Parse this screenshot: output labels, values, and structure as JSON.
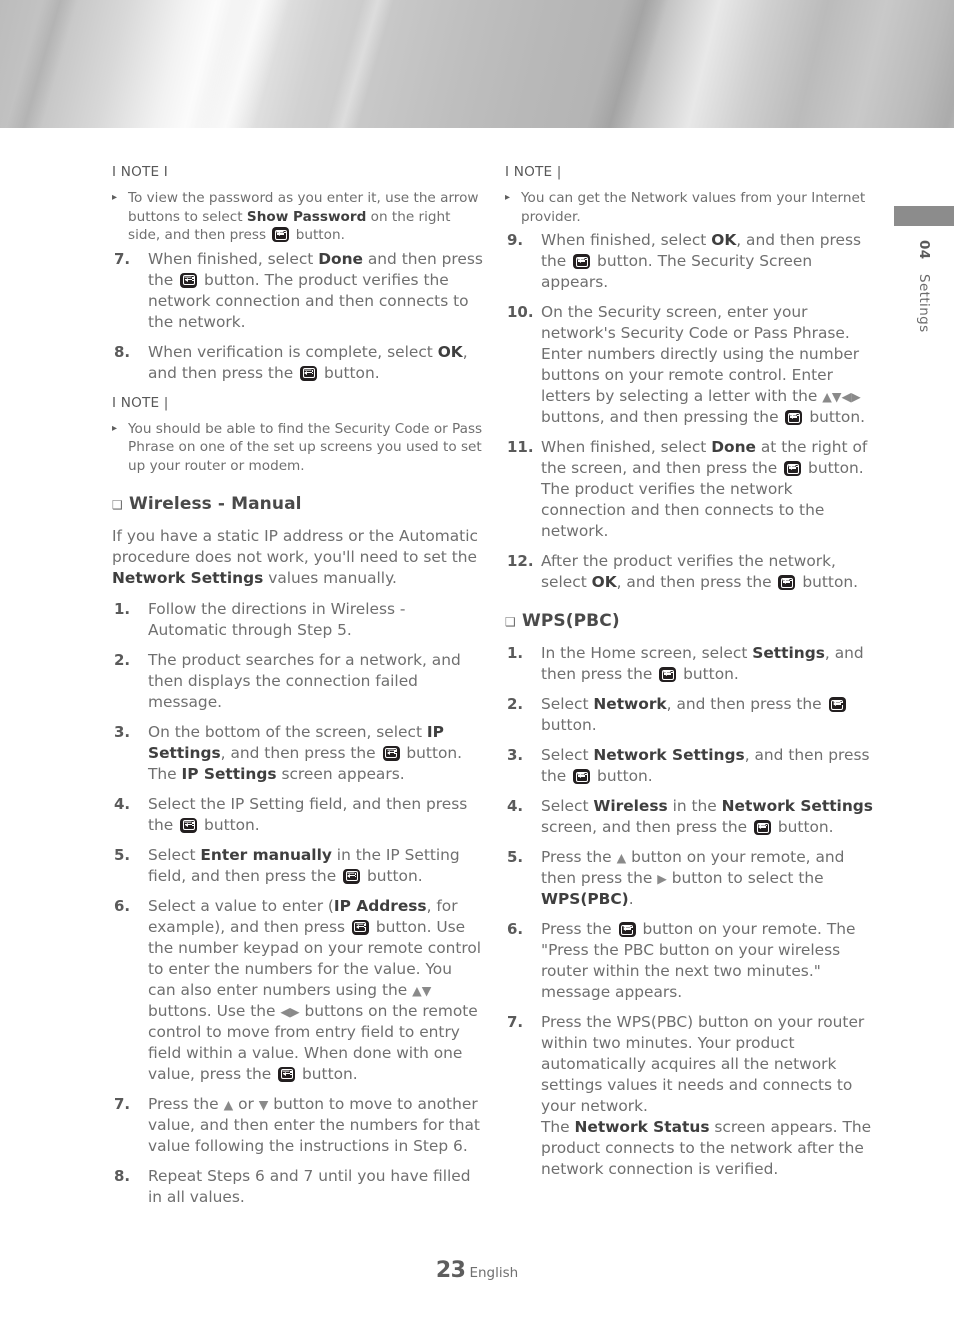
{
  "chapter_tab": {
    "number": "04",
    "name": "Settings"
  },
  "footer": {
    "page_number": "23",
    "language": "English"
  },
  "left_column": {
    "note_1": {
      "title": "I NOTE I",
      "bullet_glyph": "▸",
      "items": [
        {
          "parts": [
            {
              "t": "To view the password as you enter it, use the arrow buttons to select "
            },
            {
              "t": "Show Password",
              "b": true
            },
            {
              "t": " on the right side, and then press "
            },
            {
              "icon": "enter-button-icon"
            },
            {
              "t": " button."
            }
          ]
        }
      ]
    },
    "steps_a": [
      {
        "num": "7.",
        "parts": [
          {
            "t": "When finished, select "
          },
          {
            "t": "Done",
            "b": true
          },
          {
            "t": " and then press the "
          },
          {
            "icon": "enter-button-icon"
          },
          {
            "t": " button. The product verifies the network connection and then connects to the network."
          }
        ]
      },
      {
        "num": "8.",
        "parts": [
          {
            "t": "When verification is complete, select "
          },
          {
            "t": "OK",
            "b": true
          },
          {
            "t": ", and then press the "
          },
          {
            "icon": "enter-button-icon"
          },
          {
            "t": " button."
          }
        ]
      }
    ],
    "note_2": {
      "title": "I NOTE |",
      "bullet_glyph": "▸",
      "items": [
        {
          "parts": [
            {
              "t": "You should be able to find the Security Code or Pass Phrase on one of the set up screens you used to set up your router or modem."
            }
          ]
        }
      ]
    },
    "section": {
      "marker": "❑",
      "heading": "Wireless - Manual",
      "intro_parts": [
        {
          "t": "If you have a static IP address or the Automatic procedure does not work, you'll need to set the "
        },
        {
          "t": "Network Settings",
          "b": true
        },
        {
          "t": " values manually."
        }
      ]
    },
    "steps_b": [
      {
        "num": "1.",
        "parts": [
          {
            "t": "Follow the directions in Wireless - Automatic through Step 5."
          }
        ]
      },
      {
        "num": "2.",
        "parts": [
          {
            "t": "The product searches for a network, and then displays the connection failed message."
          }
        ]
      },
      {
        "num": "3.",
        "parts": [
          {
            "t": "On the bottom of the screen, select "
          },
          {
            "t": "IP Settings",
            "b": true
          },
          {
            "t": ", and then press the "
          },
          {
            "icon": "enter-button-icon"
          },
          {
            "t": " button. The "
          },
          {
            "t": "IP Settings",
            "b": true
          },
          {
            "t": " screen appears."
          }
        ]
      },
      {
        "num": "4.",
        "parts": [
          {
            "t": "Select the IP Setting field, and then press the "
          },
          {
            "icon": "enter-button-icon"
          },
          {
            "t": " button."
          }
        ]
      },
      {
        "num": "5.",
        "parts": [
          {
            "t": "Select "
          },
          {
            "t": "Enter manually",
            "b": true
          },
          {
            "t": " in the IP Setting field, and then press the "
          },
          {
            "icon": "enter-button-icon"
          },
          {
            "t": " button."
          }
        ]
      },
      {
        "num": "6.",
        "parts": [
          {
            "t": "Select a value to enter ("
          },
          {
            "t": "IP Address",
            "b": true
          },
          {
            "t": ", for example), and then press "
          },
          {
            "icon": "enter-button-icon"
          },
          {
            "t": " button. Use the number keypad on your remote control to enter the numbers for the value. You can also enter numbers using the "
          },
          {
            "arrows": "▲▼"
          },
          {
            "t": " buttons. Use the "
          },
          {
            "arrows": "◀▶"
          },
          {
            "t": " buttons on the remote control to move from entry field to entry field within a value. When done with one value, press the "
          },
          {
            "icon": "enter-button-icon"
          },
          {
            "t": " button."
          }
        ]
      },
      {
        "num": "7.",
        "parts": [
          {
            "t": "Press the "
          },
          {
            "arrows": "▲"
          },
          {
            "t": " or "
          },
          {
            "arrows": "▼"
          },
          {
            "t": " button to move to another value, and then enter the numbers for that value following the instructions in Step 6."
          }
        ]
      },
      {
        "num": "8.",
        "parts": [
          {
            "t": "Repeat Steps 6 and 7 until you have filled in all values."
          }
        ]
      }
    ]
  },
  "right_column": {
    "note_1": {
      "title": "I NOTE |",
      "bullet_glyph": "▸",
      "items": [
        {
          "parts": [
            {
              "t": "You can get the Network values from your Internet provider."
            }
          ]
        }
      ]
    },
    "steps_a": [
      {
        "num": "9.",
        "parts": [
          {
            "t": "When finished, select "
          },
          {
            "t": "OK",
            "b": true
          },
          {
            "t": ", and then press the "
          },
          {
            "icon": "enter-button-icon"
          },
          {
            "t": " button. The Security Screen appears."
          }
        ]
      },
      {
        "num": "10.",
        "parts": [
          {
            "t": "On the Security screen, enter your network's Security Code or Pass Phrase. Enter numbers directly using the number buttons on your remote control. Enter letters by selecting a letter with the "
          },
          {
            "arrows": "▲▼◀▶"
          },
          {
            "t": " buttons, and then pressing the "
          },
          {
            "icon": "enter-button-icon"
          },
          {
            "t": " button."
          }
        ]
      },
      {
        "num": "11.",
        "parts": [
          {
            "t": "When finished, select "
          },
          {
            "t": "Done",
            "b": true
          },
          {
            "t": " at the right of the screen, and then press the "
          },
          {
            "icon": "enter-button-icon"
          },
          {
            "t": " button. The product verifies the network connection and then connects to the network."
          }
        ]
      },
      {
        "num": "12.",
        "parts": [
          {
            "t": "After the product verifies the network, select "
          },
          {
            "t": "OK",
            "b": true
          },
          {
            "t": ", and then press the "
          },
          {
            "icon": "enter-button-icon"
          },
          {
            "t": " button."
          }
        ]
      }
    ],
    "section": {
      "marker": "❑",
      "heading": "WPS(PBC)"
    },
    "steps_b": [
      {
        "num": "1.",
        "parts": [
          {
            "t": "In the Home screen, select "
          },
          {
            "t": "Settings",
            "b": true
          },
          {
            "t": ", and then press the "
          },
          {
            "icon": "enter-button-icon"
          },
          {
            "t": " button."
          }
        ]
      },
      {
        "num": "2.",
        "parts": [
          {
            "t": "Select "
          },
          {
            "t": "Network",
            "b": true
          },
          {
            "t": ", and then press the "
          },
          {
            "icon": "enter-button-icon"
          },
          {
            "t": " button."
          }
        ]
      },
      {
        "num": "3.",
        "parts": [
          {
            "t": "Select "
          },
          {
            "t": "Network Settings",
            "b": true
          },
          {
            "t": ", and then press the "
          },
          {
            "icon": "enter-button-icon"
          },
          {
            "t": " button."
          }
        ]
      },
      {
        "num": "4.",
        "parts": [
          {
            "t": "Select "
          },
          {
            "t": "Wireless",
            "b": true
          },
          {
            "t": " in the "
          },
          {
            "t": "Network Settings",
            "b": true
          },
          {
            "t": " screen, and then press the "
          },
          {
            "icon": "enter-button-icon"
          },
          {
            "t": " button."
          }
        ]
      },
      {
        "num": "5.",
        "parts": [
          {
            "t": "Press the "
          },
          {
            "arrows": "▲"
          },
          {
            "t": " button on your remote, and then press the "
          },
          {
            "arrows": "▶"
          },
          {
            "t": " button to select the "
          },
          {
            "t": "WPS(PBC)",
            "b": true
          },
          {
            "t": "."
          }
        ]
      },
      {
        "num": "6.",
        "parts": [
          {
            "t": "Press the "
          },
          {
            "icon": "enter-button-icon"
          },
          {
            "t": " button on your remote. The \"Press the PBC button on your wireless router within the next two minutes.\" message appears."
          }
        ]
      },
      {
        "num": "7.",
        "parts": [
          {
            "t": "Press the WPS(PBC) button on your router within two minutes. Your product automatically acquires all the network settings values it needs and connects to your network."
          },
          {
            "br": true
          },
          {
            "t": "The "
          },
          {
            "t": "Network Status",
            "b": true
          },
          {
            "t": " screen appears. The product connects to the network after the network connection is verified."
          }
        ]
      }
    ]
  },
  "colors": {
    "body_text": "#6f6f6f",
    "bold_text": "#3f3f3f",
    "heading": "#4a4a4a",
    "tab_bar": "#8c8c8c",
    "icon_bg": "#231f20"
  }
}
